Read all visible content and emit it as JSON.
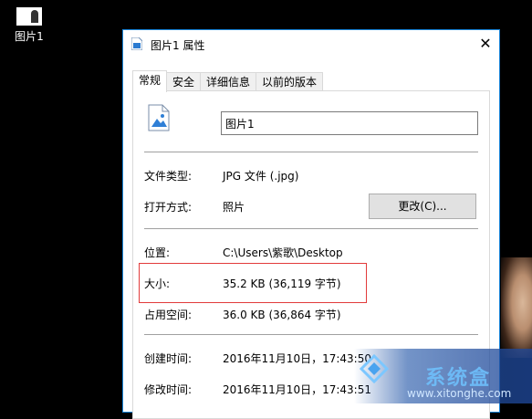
{
  "desktop": {
    "icon_label": "图片1"
  },
  "window": {
    "title": "图片1 属性",
    "close_glyph": "✕",
    "tabs": [
      {
        "label": "常规",
        "active": true
      },
      {
        "label": "安全",
        "active": false
      },
      {
        "label": "详细信息",
        "active": false
      },
      {
        "label": "以前的版本",
        "active": false
      }
    ],
    "file_name": "图片1",
    "props": {
      "type_label": "文件类型:",
      "type_value": "JPG 文件 (.jpg)",
      "open_label": "打开方式:",
      "open_value": "照片",
      "change_button": "更改(C)...",
      "location_label": "位置:",
      "location_value": "C:\\Users\\紫歌\\Desktop",
      "size_label": "大小:",
      "size_value": "35.2 KB (36,119 字节)",
      "disk_label": "占用空间:",
      "disk_value": "36.0 KB (36,864 字节)",
      "created_label": "创建时间:",
      "created_value": "2016年11月10日，17:43:50",
      "modified_label": "修改时间:",
      "modified_value": "2016年11月10日，17:43:51"
    }
  },
  "watermark": {
    "title": "系统盒",
    "url": "www.xitonghe.com"
  },
  "colors": {
    "window_border": "#1883d7",
    "highlight": "#e23b3b",
    "desktop": "#000000"
  }
}
